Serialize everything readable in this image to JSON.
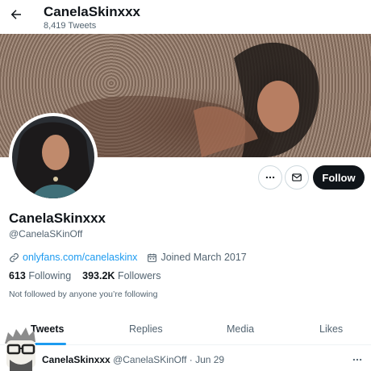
{
  "header": {
    "title": "CanelaSkinxxx",
    "subtitle": "8,419 Tweets",
    "back_icon": "arrow-left-icon"
  },
  "profile": {
    "display_name": "CanelaSkinxxx",
    "handle": "@CanelaSKinOff",
    "website": "onlyfans.com/canelaskinx",
    "joined": "Joined March 2017",
    "following_count": "613",
    "following_label": "Following",
    "followers_count": "393.2K",
    "followers_label": "Followers",
    "not_followed_text": "Not followed by anyone you’re following"
  },
  "actions": {
    "more_icon": "more-horizontal-icon",
    "message_icon": "envelope-icon",
    "follow_label": "Follow"
  },
  "tabs": [
    {
      "label": "Tweets",
      "active": true
    },
    {
      "label": "Replies",
      "active": false
    },
    {
      "label": "Media",
      "active": false
    },
    {
      "label": "Likes",
      "active": false
    }
  ],
  "tweet": {
    "name": "CanelaSkinxxx",
    "handle": "@CanelaSKinOff",
    "date": "· Jun 29",
    "more_icon": "more-horizontal-icon"
  },
  "colors": {
    "accent": "#1d9bf0",
    "text_primary": "#0f1419",
    "text_secondary": "#536471",
    "follow_bg": "#0f1419"
  }
}
